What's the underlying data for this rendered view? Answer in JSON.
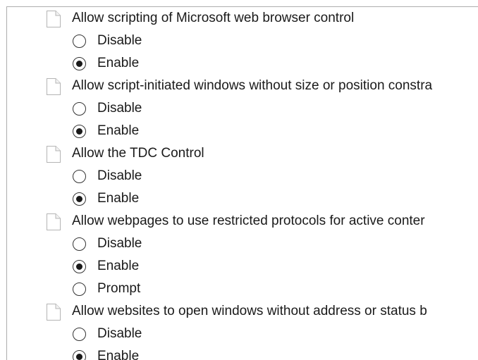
{
  "policy_list": {
    "items": [
      {
        "label": "Allow scripting of Microsoft web browser control",
        "icon": "document-icon",
        "options": [
          {
            "label": "Disable",
            "selected": false
          },
          {
            "label": "Enable",
            "selected": true
          }
        ]
      },
      {
        "label": "Allow script-initiated windows without size or position constra",
        "icon": "document-icon",
        "options": [
          {
            "label": "Disable",
            "selected": false
          },
          {
            "label": "Enable",
            "selected": true
          }
        ]
      },
      {
        "label": "Allow the TDC Control",
        "icon": "document-icon",
        "options": [
          {
            "label": "Disable",
            "selected": false
          },
          {
            "label": "Enable",
            "selected": true
          }
        ]
      },
      {
        "label": "Allow webpages to use restricted protocols for active conter",
        "icon": "document-icon",
        "options": [
          {
            "label": "Disable",
            "selected": false
          },
          {
            "label": "Enable",
            "selected": true
          },
          {
            "label": "Prompt",
            "selected": false
          }
        ]
      },
      {
        "label": "Allow websites to open windows without address or status b",
        "icon": "document-icon",
        "options": [
          {
            "label": "Disable",
            "selected": false
          },
          {
            "label": "Enable",
            "selected": true
          }
        ]
      }
    ]
  },
  "colors": {
    "border": "#adadad",
    "text": "#1a1a1a",
    "icon_fill": "#ffffff",
    "icon_stroke": "#b4b4b4"
  }
}
